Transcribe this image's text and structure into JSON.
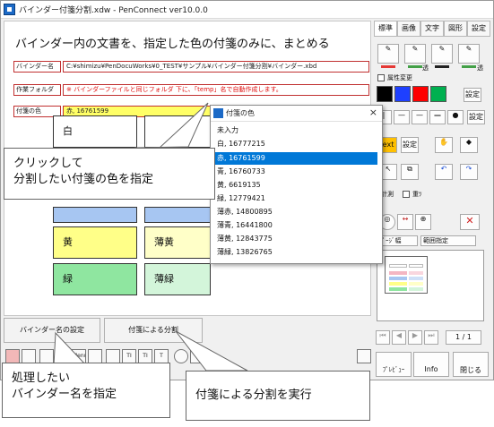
{
  "window": {
    "title": "バインダー付箋分割.xdw - PenConnect ver10.0.0"
  },
  "page": {
    "heading": "バインダー内の文書を、指定した色の付箋のみに、まとめる",
    "fields": [
      {
        "label": "バインダー名",
        "value": "C:¥shimizu¥PenDocuWorks¥0_TEST¥サンプル¥バインダー付箋分割¥バインダー.xbd"
      },
      {
        "label": "作業フォルダ",
        "value": "※ バインダーファイルと同じフォルダ 下に、「temp」名で自動作成します。"
      },
      {
        "label": "付箋の色",
        "value": "赤, 16761599"
      }
    ],
    "notes": [
      "白",
      "黄",
      "薄黄",
      "緑",
      "薄緑"
    ]
  },
  "picker": {
    "title": "付箋の色",
    "close": "×",
    "items": [
      "未入力",
      "白, 16777215",
      "赤, 16761599",
      "青, 16760733",
      "黄, 6619135",
      "緑, 12779421",
      "薄赤, 14800895",
      "薄青, 16441800",
      "薄黄, 12843775",
      "薄緑, 13826765"
    ],
    "selected_index": 2
  },
  "tools": {
    "tabs": [
      "標準",
      "画像",
      "文字",
      "図形",
      "設定"
    ],
    "attr_change": "属性変更",
    "settings": "設定",
    "text_label": "ext",
    "measure": "計測",
    "overlay": "重ﾂ",
    "width_select": "ﾍﾟｰｼﾞ幅",
    "range_select": "範囲指定",
    "page_counter": "1 / 1",
    "page_input": "1",
    "preview": "ﾌﾟﾚﾋﾞｭｰ",
    "info": "Info",
    "close": "閉じる",
    "pen_colors": [
      "#e53935",
      "#43a047",
      "#222222",
      "#43a047"
    ],
    "pen_labels": [
      "",
      "透",
      "",
      "透"
    ],
    "swatches": [
      "#000000",
      "#1e40ff",
      "#ff0000",
      "#00b050"
    ]
  },
  "bottom": {
    "binder_button": "バインダー名の設定",
    "split_button": "付箋による分割",
    "icons": [
      "Menu",
      "TI",
      "TI",
      "T"
    ]
  },
  "callouts": {
    "click": "クリックして\n分割したい付箋の色を指定",
    "binder": "処理したい\nバインダー名を指定",
    "split": "付箋による分割を実行"
  },
  "colors": {
    "selection": "#0078d7",
    "field_border": "#c03030",
    "field_highlight": "#ffff66",
    "note_white": "#ffffff",
    "note_blue": "#a7c6f2",
    "note_yellow": "#ffff88",
    "note_lightyellow": "#ffffc8",
    "note_green": "#8fe6a0",
    "note_lightgreen": "#d3f5da"
  }
}
